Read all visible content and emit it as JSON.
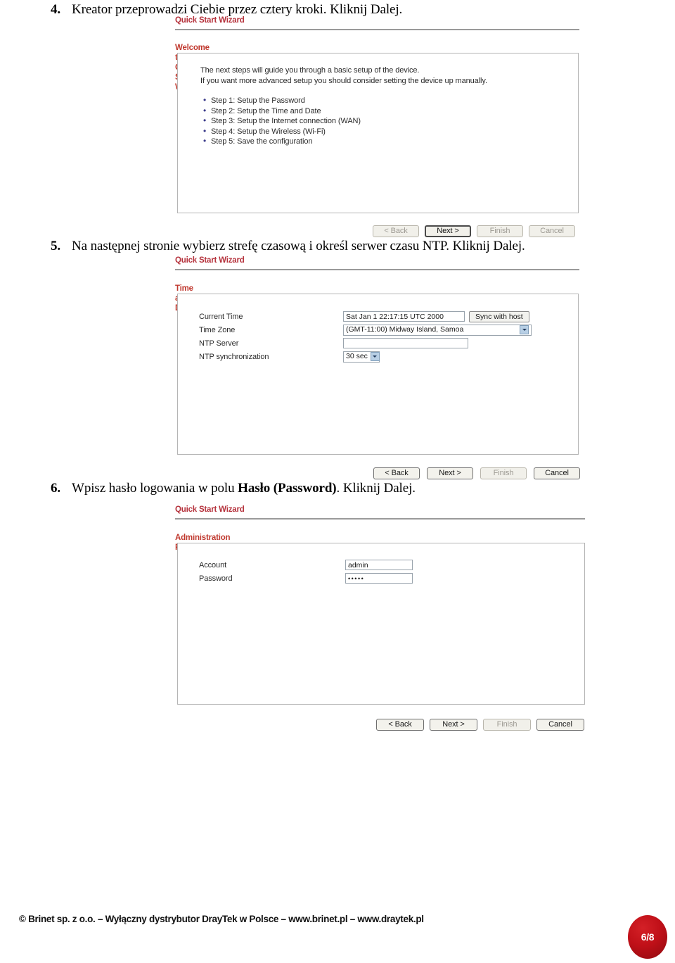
{
  "document": {
    "footer_text": "© Brinet sp. z o.o. – Wyłączny dystrybutor DrayTek w Polsce – www.brinet.pl – www.draytek.pl",
    "page_number": "6/8"
  },
  "instructions": [
    {
      "num": "4.",
      "text": "Kreator przeprowadzi Ciebie przez cztery kroki. Kliknij Dalej."
    },
    {
      "num": "5.",
      "text": "Na następnej stronie wybierz strefę czasową i określ serwer czasu NTP. Kliknij Dalej."
    },
    {
      "num": "6.",
      "pre": "Wpisz hasło logowania w polu ",
      "bold": "Hasło (Password)",
      "post": ". Kliknij Dalej."
    }
  ],
  "panel_welcome": {
    "wizard_title": "Quick Start Wizard",
    "section_title": "Welcome to the Quick Start Wizard!",
    "intro_line1": "The next steps will guide you through a basic setup of the device.",
    "intro_line2": "If you want more advanced setup you should consider setting the device up manually.",
    "steps": [
      "Step 1: Setup the Password",
      "Step 2: Setup the Time and Date",
      "Step 3: Setup the Internet connection (WAN)",
      "Step 4: Setup the Wireless (Wi-Fi)",
      "Step 5: Save the configuration"
    ],
    "buttons": {
      "back": "< Back",
      "next": "Next >",
      "finish": "Finish",
      "cancel": "Cancel"
    }
  },
  "panel_time": {
    "wizard_title": "Quick Start Wizard",
    "section_title": "Time and Date",
    "labels": {
      "current_time": "Current Time",
      "time_zone": "Time Zone",
      "ntp_server": "NTP Server",
      "ntp_sync": "NTP synchronization"
    },
    "values": {
      "current_time": "Sat Jan  1 22:17:15 UTC 2000",
      "sync_button": "Sync with host",
      "time_zone": "(GMT-11:00) Midway Island, Samoa",
      "ntp_server": "",
      "ntp_sync": "30 sec"
    },
    "buttons": {
      "back": "< Back",
      "next": "Next >",
      "finish": "Finish",
      "cancel": "Cancel"
    }
  },
  "panel_password": {
    "wizard_title": "Quick Start Wizard",
    "section_title": "Administration Password",
    "labels": {
      "account": "Account",
      "password": "Password"
    },
    "values": {
      "account": "admin",
      "password": "•••••"
    },
    "buttons": {
      "back": "< Back",
      "next": "Next >",
      "finish": "Finish",
      "cancel": "Cancel"
    }
  }
}
